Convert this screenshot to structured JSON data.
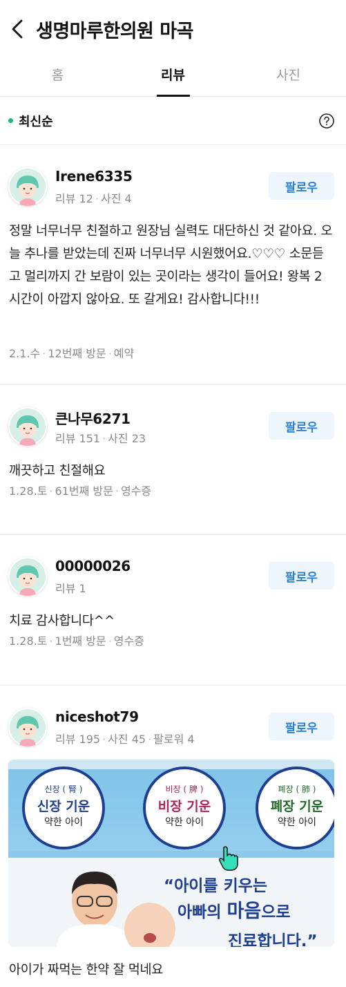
{
  "header": {
    "title": "생명마루한의원 마곡"
  },
  "tabs": [
    {
      "label": "홈",
      "active": false
    },
    {
      "label": "리뷰",
      "active": true
    },
    {
      "label": "사진",
      "active": false
    }
  ],
  "sort": {
    "label": "최신순"
  },
  "follow_label": "팔로우",
  "reviews": [
    {
      "user": "Irene6335",
      "stats": [
        "리뷰 12",
        "사진 4"
      ],
      "text": "정말 너무너무 친절하고 원장님 실력도 대단하신 것 같아요. 오늘 추나를 받았는데 진짜 너무너무 시원했어요.♡♡♡ 소문듣고 멀리까지 간 보람이 있는 곳이라는 생각이 들어요! 왕복 2시간이 아깝지 않아요. 또 갈게요! 감사합니다!!!",
      "footer": [
        "2.1.수",
        "12번째 방문",
        "예약"
      ]
    },
    {
      "user": "큰나무6271",
      "stats": [
        "리뷰 151",
        "사진 23"
      ],
      "text": "깨끗하고 친절해요",
      "footer": [
        "1.28.토",
        "61번째 방문",
        "영수증"
      ]
    },
    {
      "user": "00000026",
      "stats": [
        "리뷰 1"
      ],
      "text": "치료 감사합니다^^",
      "footer": [
        "1.28.토",
        "1번째 방문",
        "영수증"
      ]
    },
    {
      "user": "niceshot79",
      "stats": [
        "리뷰 195",
        "사진 45",
        "팔로워 4"
      ],
      "text": "아이가 짜먹는 한약 잘 먹네요",
      "photo": {
        "circles": [
          {
            "top": "신장 ( 腎 )",
            "main": "신장 기운",
            "sub": "약한 아이",
            "color": "#1e3f8f"
          },
          {
            "top": "비장 ( 脾 )",
            "main": "비장 기운",
            "sub": "약한 아이",
            "color": "#b0245a"
          },
          {
            "top": "폐장 ( 肺 )",
            "main": "폐장 기운",
            "sub": "약한 아이",
            "color": "#1f6b2a"
          }
        ],
        "quote_line1": "“아이를 키우는",
        "quote_line2_a": "아빠의 ",
        "quote_line2_b": "마음",
        "quote_line2_c": "으로",
        "quote_line3": "진료합니다.”"
      }
    }
  ]
}
